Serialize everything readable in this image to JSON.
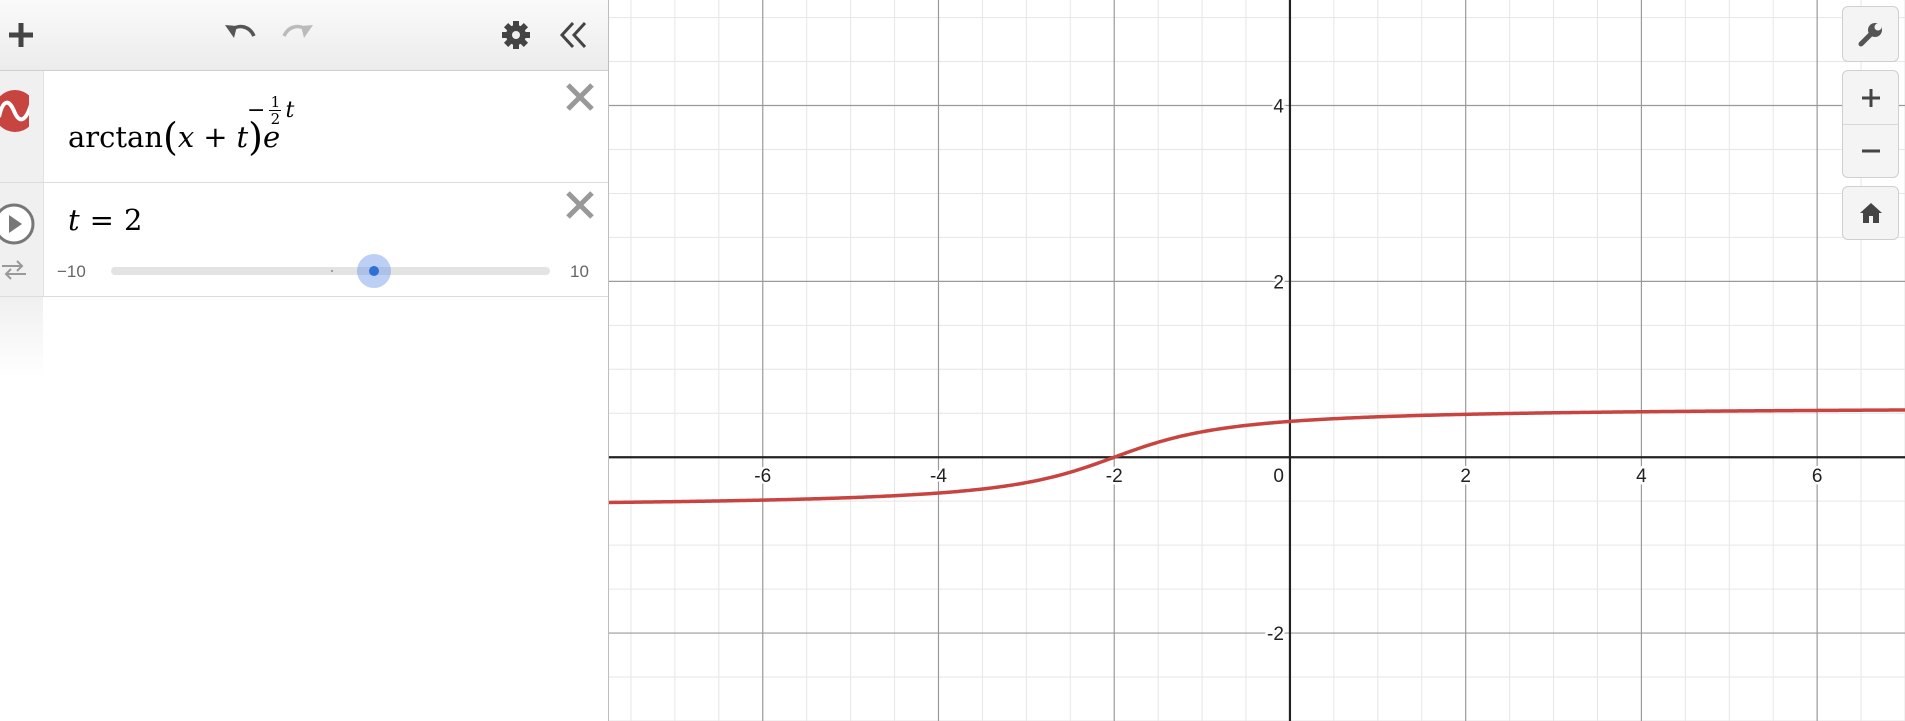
{
  "toolbar": {
    "add_icon": "plus-icon",
    "undo_icon": "undo-icon",
    "redo_icon": "redo-icon",
    "settings_icon": "gear-icon",
    "collapse_icon": "double-chevron-left-icon"
  },
  "expressions": [
    {
      "id": 1,
      "icon": "graph-wave-icon",
      "color": "#c74440",
      "latex_parts": {
        "func": "arctan",
        "open": "(",
        "var_x": "x",
        "plus": "+",
        "var_t": "t",
        "close": ")",
        "base": "e",
        "exp_sign": "−",
        "exp_num": "1",
        "exp_den": "2",
        "exp_var": "t"
      }
    },
    {
      "id": 2,
      "icon": "play-icon",
      "secondary_icon": "repeat-icon",
      "var": "t",
      "eq": "=",
      "value": "2",
      "slider": {
        "min_label": "−10",
        "max_label": "10",
        "min": -10,
        "max": 10,
        "value": 2
      }
    }
  ],
  "graph": {
    "x_ticks": [
      "-6",
      "-4",
      "-2",
      "0",
      "2",
      "4",
      "6"
    ],
    "y_ticks": [
      "4",
      "2",
      "-2"
    ],
    "xlim": [
      -7.75,
      7.0
    ],
    "ylim": [
      -3.0,
      5.2
    ],
    "curve_color": "#c74440",
    "t": 2
  },
  "controls": {
    "wrench_icon": "wrench-icon",
    "zoom_in_icon": "plus-icon",
    "zoom_out_icon": "minus-icon",
    "home_icon": "home-icon"
  }
}
